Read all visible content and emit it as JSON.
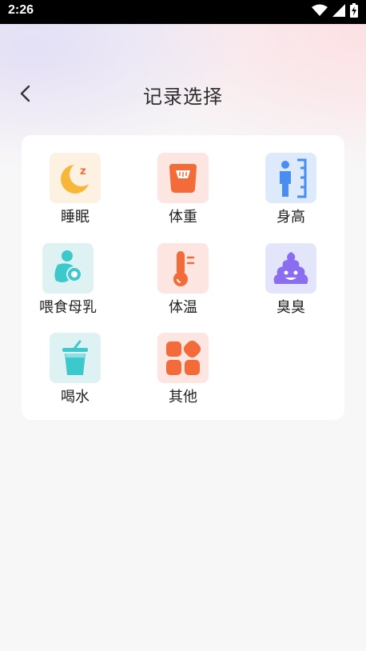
{
  "status_bar": {
    "time": "2:26",
    "icons": [
      "wifi-icon",
      "signal-icon",
      "battery-charging-icon"
    ]
  },
  "header": {
    "back_icon": "chevron-left-icon",
    "title": "记录选择"
  },
  "grid": {
    "items": [
      {
        "label": "睡眠",
        "icon": "sleep-moon-icon"
      },
      {
        "label": "体重",
        "icon": "scale-icon"
      },
      {
        "label": "身高",
        "icon": "height-ruler-icon"
      },
      {
        "label": "喂食母乳",
        "icon": "breastfeeding-icon"
      },
      {
        "label": "体温",
        "icon": "thermometer-icon"
      },
      {
        "label": "臭臭",
        "icon": "poop-icon"
      },
      {
        "label": "喝水",
        "icon": "water-cup-icon"
      },
      {
        "label": "其他",
        "icon": "other-grid-icon"
      }
    ]
  },
  "colors": {
    "accent_orange": "#f36b38",
    "accent_yellow": "#f7b73a",
    "accent_blue": "#4a8df0",
    "accent_teal": "#3dc8cc",
    "accent_purple": "#8a6df0"
  }
}
